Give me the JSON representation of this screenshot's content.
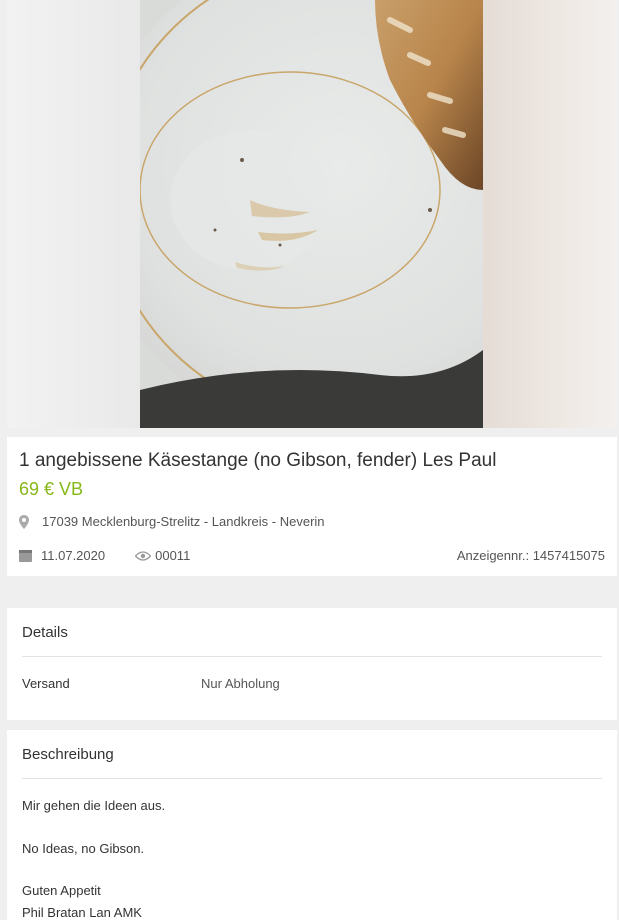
{
  "listing": {
    "title": "1 angebissene Käsestange (no Gibson, fender) Les Paul",
    "price": "69 € VB",
    "location": "17039 Mecklenburg-Strelitz - Landkreis - Neverin",
    "date": "11.07.2020",
    "views": "00011",
    "ad_number": "Anzeigennr.: 1457415075"
  },
  "details": {
    "heading": "Details",
    "rows": [
      {
        "label": "Versand",
        "value": "Nur Abholung"
      }
    ]
  },
  "description": {
    "heading": "Beschreibung",
    "lines": [
      "Mir gehen die Ideen aus.",
      "No Ideas, no Gibson.",
      "Guten Appetit",
      "Phil Bratan Lan AMK"
    ]
  },
  "icons": {
    "location": "map-pin-icon",
    "date": "calendar-icon",
    "views": "eye-icon"
  },
  "colors": {
    "price": "#86b817",
    "background": "#efefef",
    "card": "#ffffff"
  }
}
